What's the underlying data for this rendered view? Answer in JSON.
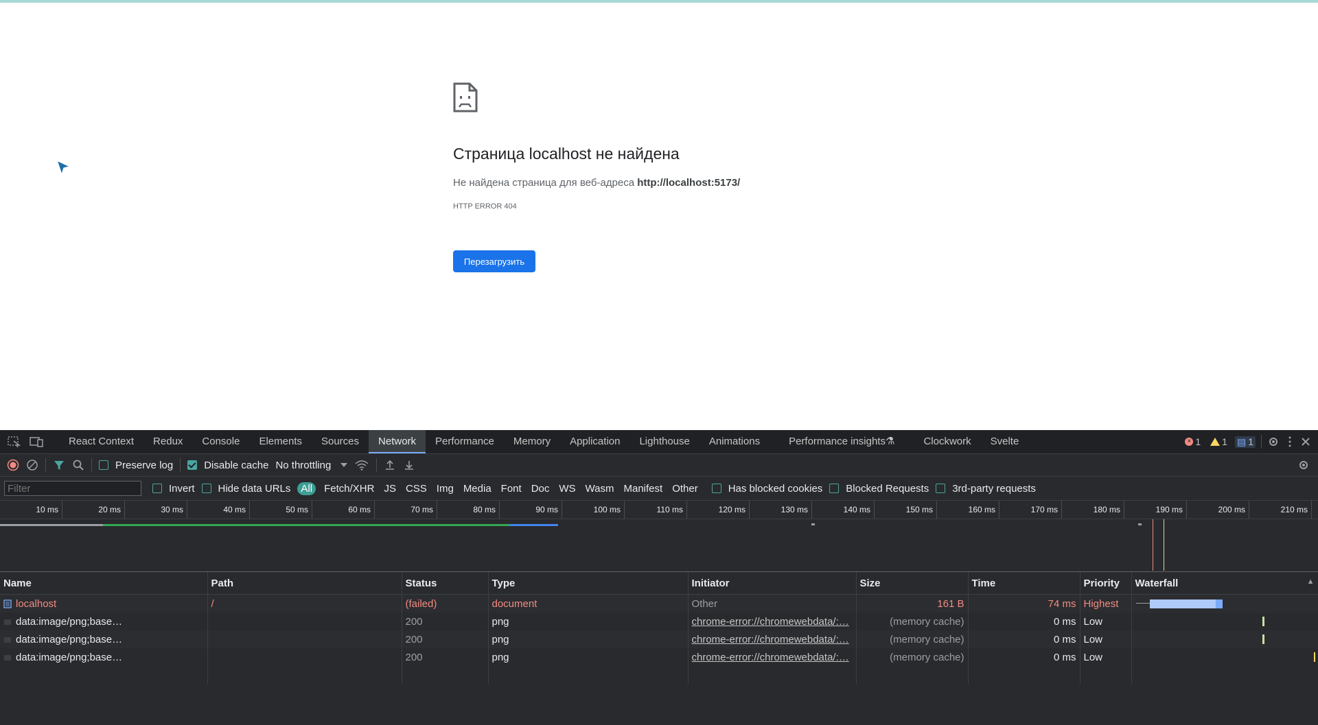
{
  "page": {
    "title": "Страница localhost не найдена",
    "message_prefix": "Не найдена страница для веб-адреса",
    "url": "http://localhost:5173/",
    "error_code": "HTTP ERROR 404",
    "reload_label": "Перезагрузить"
  },
  "devtools": {
    "tabs": [
      "React Context",
      "Redux",
      "Console",
      "Elements",
      "Sources",
      "Network",
      "Performance",
      "Memory",
      "Application",
      "Lighthouse",
      "Animations",
      "Performance insights",
      "Clockwork",
      "Svelte"
    ],
    "active_tab": "Network",
    "badges": {
      "errors": "1",
      "warnings": "1",
      "messages": "1"
    },
    "toolbar": {
      "preserve_log": "Preserve log",
      "disable_cache": "Disable cache",
      "throttling": "No throttling"
    },
    "filter": {
      "placeholder": "Filter",
      "invert": "Invert",
      "hide_data_urls": "Hide data URLs",
      "types": [
        "All",
        "Fetch/XHR",
        "JS",
        "CSS",
        "Img",
        "Media",
        "Font",
        "Doc",
        "WS",
        "Wasm",
        "Manifest",
        "Other"
      ],
      "active_type": "All",
      "has_blocked_cookies": "Has blocked cookies",
      "blocked_requests": "Blocked Requests",
      "third_party": "3rd-party requests"
    },
    "ruler": [
      "10 ms",
      "20 ms",
      "30 ms",
      "40 ms",
      "50 ms",
      "60 ms",
      "70 ms",
      "80 ms",
      "90 ms",
      "100 ms",
      "110 ms",
      "120 ms",
      "130 ms",
      "140 ms",
      "150 ms",
      "160 ms",
      "170 ms",
      "180 ms",
      "190 ms",
      "200 ms",
      "210 ms"
    ],
    "columns": [
      "Name",
      "Path",
      "Status",
      "Type",
      "Initiator",
      "Size",
      "Time",
      "Priority",
      "Waterfall"
    ],
    "rows": [
      {
        "name": "localhost",
        "path": "/",
        "status": "(failed)",
        "type": "document",
        "initiator": "Other",
        "size": "161 B",
        "time": "74 ms",
        "priority": "Highest"
      },
      {
        "name": "data:image/png;base…",
        "path": "",
        "status": "200",
        "type": "png",
        "initiator": "chrome-error://chromewebdata/:…",
        "size": "(memory cache)",
        "time": "0 ms",
        "priority": "Low"
      },
      {
        "name": "data:image/png;base…",
        "path": "",
        "status": "200",
        "type": "png",
        "initiator": "chrome-error://chromewebdata/:…",
        "size": "(memory cache)",
        "time": "0 ms",
        "priority": "Low"
      },
      {
        "name": "data:image/png;base…",
        "path": "",
        "status": "200",
        "type": "png",
        "initiator": "chrome-error://chromewebdata/:…",
        "size": "(memory cache)",
        "time": "0 ms",
        "priority": "Low"
      }
    ]
  }
}
